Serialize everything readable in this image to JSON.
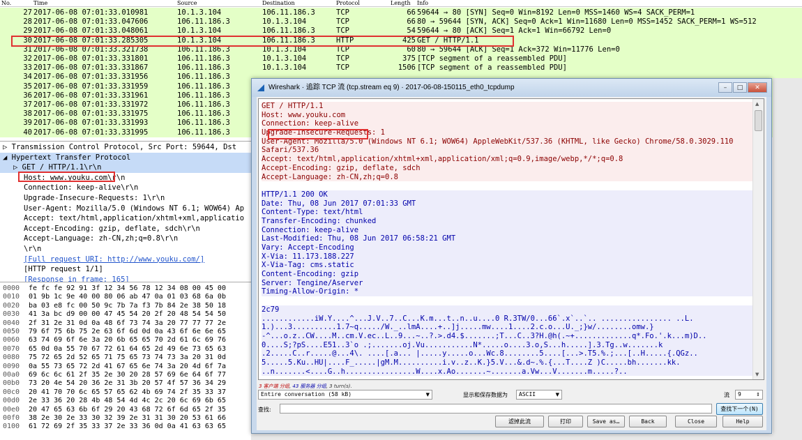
{
  "packet_list": {
    "columns": [
      "No.",
      "Time",
      "Source",
      "Destination",
      "Protocol",
      "Length",
      "Info"
    ],
    "rows": [
      {
        "no": "27",
        "time": "2017-06-08 07:01:33.010981",
        "src": "10.1.3.104",
        "dst": "106.11.186.3",
        "proto": "TCP",
        "len": "66",
        "info": "59644 → 80 [SYN] Seq=0 Win=8192 Len=0 MSS=1460 WS=4 SACK_PERM=1"
      },
      {
        "no": "28",
        "time": "2017-06-08 07:01:33.047606",
        "src": "106.11.186.3",
        "dst": "10.1.3.104",
        "proto": "TCP",
        "len": "66",
        "info": "80 → 59644 [SYN, ACK] Seq=0 Ack=1 Win=11680 Len=0 MSS=1452 SACK_PERM=1 WS=512"
      },
      {
        "no": "29",
        "time": "2017-06-08 07:01:33.048061",
        "src": "10.1.3.104",
        "dst": "106.11.186.3",
        "proto": "TCP",
        "len": "54",
        "info": "59644 → 80 [ACK] Seq=1 Ack=1 Win=66792 Len=0"
      },
      {
        "no": "30",
        "time": "2017-06-08 07:01:33.285305",
        "src": "10.1.3.104",
        "dst": "106.11.186.3",
        "proto": "HTTP",
        "len": "425",
        "info": "GET / HTTP/1.1"
      },
      {
        "no": "31",
        "time": "2017-06-08 07:01:33.321738",
        "src": "106.11.186.3",
        "dst": "10.1.3.104",
        "proto": "TCP",
        "len": "60",
        "info": "80 → 59644 [ACK] Seq=1 Ack=372 Win=11776 Len=0"
      },
      {
        "no": "32",
        "time": "2017-06-08 07:01:33.331801",
        "src": "106.11.186.3",
        "dst": "10.1.3.104",
        "proto": "TCP",
        "len": "375",
        "info": "[TCP segment of a reassembled PDU]"
      },
      {
        "no": "33",
        "time": "2017-06-08 07:01:33.331867",
        "src": "106.11.186.3",
        "dst": "10.1.3.104",
        "proto": "TCP",
        "len": "1506",
        "info": "[TCP segment of a reassembled PDU]"
      },
      {
        "no": "34",
        "time": "2017-06-08 07:01:33.331956",
        "src": "106.11.186.3",
        "dst": "",
        "proto": "",
        "len": "",
        "info": ""
      },
      {
        "no": "35",
        "time": "2017-06-08 07:01:33.331959",
        "src": "106.11.186.3",
        "dst": "",
        "proto": "",
        "len": "",
        "info": ""
      },
      {
        "no": "36",
        "time": "2017-06-08 07:01:33.331961",
        "src": "106.11.186.3",
        "dst": "",
        "proto": "",
        "len": "",
        "info": ""
      },
      {
        "no": "37",
        "time": "2017-06-08 07:01:33.331972",
        "src": "106.11.186.3",
        "dst": "",
        "proto": "",
        "len": "",
        "info": ""
      },
      {
        "no": "38",
        "time": "2017-06-08 07:01:33.331975",
        "src": "106.11.186.3",
        "dst": "",
        "proto": "",
        "len": "",
        "info": ""
      },
      {
        "no": "39",
        "time": "2017-06-08 07:01:33.331993",
        "src": "106.11.186.3",
        "dst": "",
        "proto": "",
        "len": "",
        "info": ""
      },
      {
        "no": "40",
        "time": "2017-06-08 07:01:33.331995",
        "src": "106.11.186.3",
        "dst": "",
        "proto": "",
        "len": "",
        "info": ""
      }
    ]
  },
  "details": {
    "rows": [
      {
        "text": "▷ Transmission Control Protocol, Src Port: 59644, Dst",
        "link": false,
        "hl": false,
        "indent": 0
      },
      {
        "text": "◢ Hypertext Transfer Protocol",
        "link": false,
        "hl": true,
        "indent": 0
      },
      {
        "text": "▷ GET / HTTP/1.1\\r\\n",
        "link": false,
        "hl": true,
        "indent": 1
      },
      {
        "text": "Host: www.youku.com\\r\\n",
        "link": false,
        "hl": false,
        "indent": 2
      },
      {
        "text": "Connection: keep-alive\\r\\n",
        "link": false,
        "hl": false,
        "indent": 2
      },
      {
        "text": "Upgrade-Insecure-Requests: 1\\r\\n",
        "link": false,
        "hl": false,
        "indent": 2
      },
      {
        "text": "User-Agent: Mozilla/5.0 (Windows NT 6.1; WOW64) Ap",
        "link": false,
        "hl": false,
        "indent": 2
      },
      {
        "text": "Accept: text/html,application/xhtml+xml,applicatio",
        "link": false,
        "hl": false,
        "indent": 2
      },
      {
        "text": "Accept-Encoding: gzip, deflate, sdch\\r\\n",
        "link": false,
        "hl": false,
        "indent": 2
      },
      {
        "text": "Accept-Language: zh-CN,zh;q=0.8\\r\\n",
        "link": false,
        "hl": false,
        "indent": 2
      },
      {
        "text": "\\r\\n",
        "link": false,
        "hl": false,
        "indent": 2
      },
      {
        "text": "[Full request URI: http://www.youku.com/]",
        "link": true,
        "hl": false,
        "indent": 2
      },
      {
        "text": "[HTTP request 1/1]",
        "link": false,
        "hl": false,
        "indent": 2
      },
      {
        "text": "[Response in frame: 165]",
        "link": true,
        "hl": false,
        "indent": 2
      }
    ]
  },
  "hex": {
    "rows": [
      {
        "off": "0000",
        "bytes": "fe fc fe 92 91 3f 12 34  56 78 12 34 08 00 45 00"
      },
      {
        "off": "0010",
        "bytes": "01 9b 1c 9e 40 00 80 06  ab 47 0a 01 03 68 6a 0b"
      },
      {
        "off": "0020",
        "bytes": "ba 03 e8 fc 00 50 9c 7b  7a f3 7b 84 2e 38 50 18"
      },
      {
        "off": "0030",
        "bytes": "41 3a bc d9 00 00 47 45  54 20 2f 20 48 54 54 50"
      },
      {
        "off": "0040",
        "bytes": "2f 31 2e 31 0d 0a 48 6f  73 74 3a 20 77 77 77 2e"
      },
      {
        "off": "0050",
        "bytes": "79 6f 75 6b 75 2e 63 6f  6d 0d 0a 43 6f 6e 6e 65"
      },
      {
        "off": "0060",
        "bytes": "63 74 69 6f 6e 3a 20 6b  65 65 70 2d 61 6c 69 76"
      },
      {
        "off": "0070",
        "bytes": "65 0d 0a 55 70 67 72 61  64 65 2d 49 6e 73 65 63"
      },
      {
        "off": "0080",
        "bytes": "75 72 65 2d 52 65 71 75  65 73 74 73 3a 20 31 0d"
      },
      {
        "off": "0090",
        "bytes": "0a 55 73 65 72 2d 41 67  65 6e 74 3a 20 4d 6f 7a"
      },
      {
        "off": "00a0",
        "bytes": "69 6c 6c 61 2f 35 2e 30  20 28 57 69 6e 64 6f 77"
      },
      {
        "off": "00b0",
        "bytes": "73 20 4e 54 20 36 2e 31  3b 20 57 4f 57 36 34 29"
      },
      {
        "off": "00c0",
        "bytes": "20 41 70 70 6c 65 57 65  62 4b 69 74 2f 35 33 37"
      },
      {
        "off": "00d0",
        "bytes": "2e 33 36 20 28 4b 48 54  4d 4c 2c 20 6c 69 6b 65"
      },
      {
        "off": "00e0",
        "bytes": "20 47 65 63 6b 6f 29 20  43 68 72 6f 6d 65 2f 35"
      },
      {
        "off": "00f0",
        "bytes": "38 2e 30 2e 33 30 32 39  2e 31 31 30 20 53 61 66"
      },
      {
        "off": "0100",
        "bytes": "61 72 69 2f 35 33 37 2e  33 36 0d 0a 41 63 63 65"
      }
    ]
  },
  "dialog": {
    "title": "Wireshark · 追踪 TCP 流 (tcp.stream eq 9) · 2017-06-08-150115_eth0_tcpdump",
    "client_lines": [
      "GET / HTTP/1.1",
      "Host: www.youku.com",
      "Connection: keep-alive",
      "Upgrade-Insecure-Requests: 1",
      "User-Agent: Mozilla/5.0 (Windows NT 6.1; WOW64) AppleWebKit/537.36 (KHTML, like Gecko) Chrome/58.0.3029.110",
      "Safari/537.36",
      "Accept: text/html,application/xhtml+xml,application/xml;q=0.9,image/webp,*/*;q=0.8",
      "Accept-Encoding: gzip, deflate, sdch",
      "Accept-Language: zh-CN,zh;q=0.8"
    ],
    "server_lines": [
      "HTTP/1.1 200 OK",
      "Date: Thu, 08 Jun 2017 07:01:33 GMT",
      "Content-Type: text/html",
      "Transfer-Encoding: chunked",
      "Connection: keep-alive",
      "Last-Modified: Thu, 08 Jun 2017 06:58:21 GMT",
      "Vary: Accept-Encoding",
      "X-Via: 11.173.188.227",
      "X-Via-Tag: cms.static",
      "Content-Encoding: gzip",
      "Server: Tengine/Aserver",
      "Timing-Allow-Origin: *"
    ],
    "server_chunk": "2c79",
    "server_binary_lines": [
      "............iW.Y....^...J.V..7..C...K.m...t..n..u....0 R.3TW/0...66`.x`..`.. ................     ..L.",
      "1.)...3..........1.7~q...../W._..lmA....+..]j.....mw....1....2.c.o...U._;}w/........omw.}",
      "-^...o.z..CW....M..cm.V.ec..L..9...~..?.>.d4.$.......;T...C..3?H.@h(.~+.............q*.Fo.'.k...m)D..",
      "0....S;?pS....E51..3`o .;.......oj.Vu...........N*.....o....3.o,S...h.....].3.Tg..w.......k",
      ".2.....C..r.....@...4\\.  ....[.a... |.....y.....o...Wc.8........5....[...>.T5.%.;...[..H.....{.QGz..",
      "5.....5.Ku..HU|....F_.....|gM.M..........i.v..z..K.}5.V...&.d~.%.{...T....Z )C.....bh.......kk.",
      "..n.......<....G..h................W....x.Ao.......~.......a.Vw...V.......m.....?.."
    ],
    "summary": {
      "client": "3 客户端 分组",
      "server": "43 服务器 分组",
      "turns": "3 turn(s)."
    },
    "conversation_select": "Entire conversation (58 kB)",
    "show_as_label": "显示和保存数据为",
    "show_as_value": "ASCII",
    "stream_label": "流",
    "stream_value": "9",
    "find_label": "查找:",
    "find_value": "",
    "find_next": "查找下一个(N)",
    "buttons": {
      "filter_out": "滤掉此流",
      "print": "打印",
      "save_as": "Save as…",
      "back": "Back",
      "close": "Close",
      "help": "Help"
    }
  }
}
